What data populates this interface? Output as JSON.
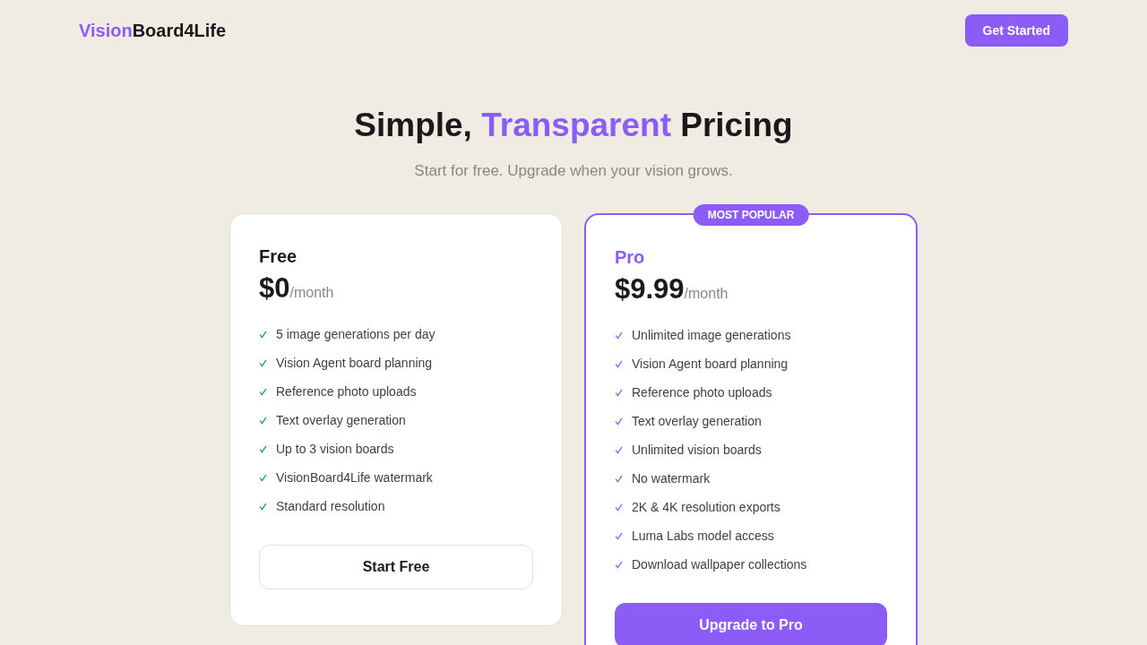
{
  "nav": {
    "logo": {
      "accent": "Vision",
      "rest": "Board4Life"
    },
    "cta": "Get Started"
  },
  "hero": {
    "title": {
      "before": "Simple, ",
      "accent": "Transparent",
      "after": " Pricing"
    },
    "subtitle": "Start for free. Upgrade when your vision grows."
  },
  "plans": [
    {
      "name": "Free",
      "featured": false,
      "price": "$0",
      "period": "/month",
      "features": [
        "5 image generations per day",
        "Vision Agent board planning",
        "Reference photo uploads",
        "Text overlay generation",
        "Up to 3 vision boards",
        "VisionBoard4Life watermark",
        "Standard resolution"
      ],
      "button": "Start Free"
    },
    {
      "name": "Pro",
      "featured": true,
      "badge": "MOST POPULAR",
      "price": "$9.99",
      "period": "/month",
      "features": [
        "Unlimited image generations",
        "Vision Agent board planning",
        "Reference photo uploads",
        "Text overlay generation",
        "Unlimited vision boards",
        "No watermark",
        "2K & 4K resolution exports",
        "Luma Labs model access",
        "Download wallpaper collections"
      ],
      "button": "Upgrade to Pro"
    }
  ]
}
